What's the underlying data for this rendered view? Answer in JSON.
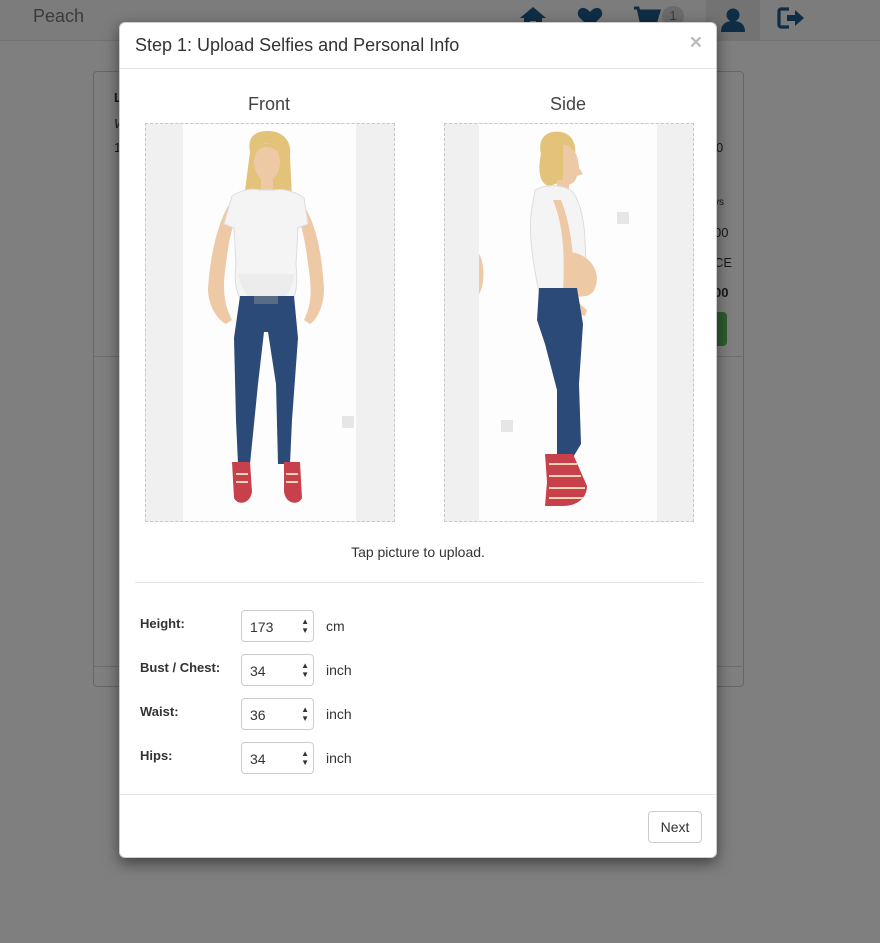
{
  "navbar": {
    "brand": "Peach",
    "cart_count": "1",
    "icons": [
      "home-icon",
      "heart-icon",
      "cart-icon",
      "user-icon",
      "sign-out-icon"
    ]
  },
  "background": {
    "fragments": [
      "L",
      "W",
      "1",
      "0",
      "vs",
      "00",
      "CE",
      "00"
    ]
  },
  "modal": {
    "title": "Step 1: Upload Selfies and Personal Info",
    "close": "×",
    "front_label": "Front",
    "side_label": "Side",
    "hint": "Tap picture to upload.",
    "fields": [
      {
        "label": "Height:",
        "value": "173",
        "unit": "cm"
      },
      {
        "label": "Bust / Chest:",
        "value": "34",
        "unit": "inch"
      },
      {
        "label": "Waist:",
        "value": "36",
        "unit": "inch"
      },
      {
        "label": "Hips:",
        "value": "34",
        "unit": "inch"
      }
    ],
    "next_label": "Next"
  },
  "colors": {
    "nav_icon": "#1f5a8a",
    "backdrop": "#808080",
    "jeans": "#2c4a78",
    "shirt": "#f4f4f4",
    "hair": "#e3c27a",
    "skin": "#eec9a6",
    "shoes": "#c7404b"
  }
}
